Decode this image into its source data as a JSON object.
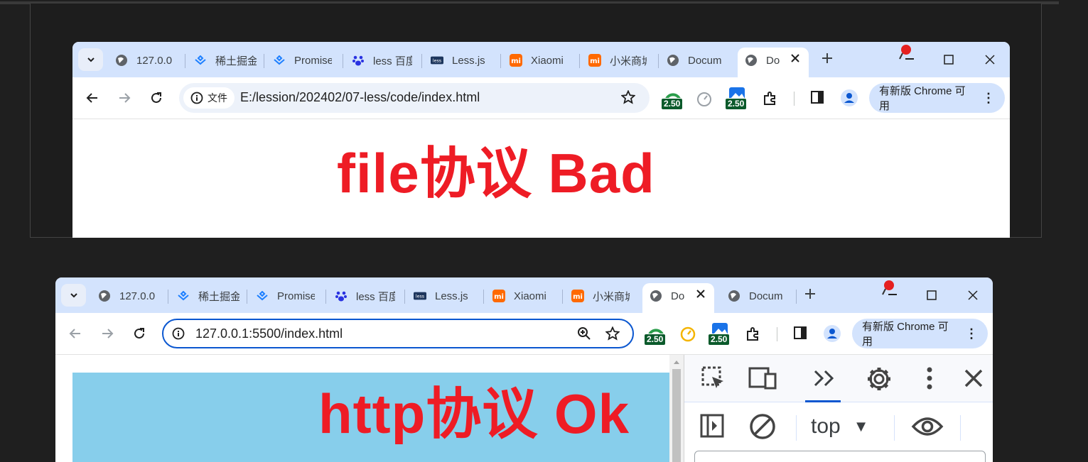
{
  "window_a": {
    "tabs": [
      {
        "title": "127.0.0",
        "icon": "globe-icon"
      },
      {
        "title": "稀土掘金",
        "icon": "juejin-icon"
      },
      {
        "title": "Promise",
        "icon": "juejin-icon"
      },
      {
        "title": "less 百度",
        "icon": "baidu-paw-icon"
      },
      {
        "title": "Less.js",
        "icon": "less-logo-icon"
      },
      {
        "title": "Xiaomi",
        "icon": "mi-logo-icon"
      },
      {
        "title": "小米商城",
        "icon": "mi-logo-icon"
      },
      {
        "title": "Docum",
        "icon": "globe-icon"
      },
      {
        "title": "Do",
        "icon": "globe-icon",
        "active": true
      }
    ],
    "security_chip": "文件",
    "url": "E:/lession/202402/07-less/code/index.html",
    "ext_badge_1": "2.50",
    "ext_badge_2": "2.50",
    "update_label": "有新版 Chrome 可用",
    "heading": "file协议  Bad"
  },
  "window_b": {
    "tabs": [
      {
        "title": "127.0.0",
        "icon": "globe-icon"
      },
      {
        "title": "稀土掘金",
        "icon": "juejin-icon"
      },
      {
        "title": "Promise",
        "icon": "juejin-icon"
      },
      {
        "title": "less 百度",
        "icon": "baidu-paw-icon"
      },
      {
        "title": "Less.js",
        "icon": "less-logo-icon"
      },
      {
        "title": "Xiaomi",
        "icon": "mi-logo-icon"
      },
      {
        "title": "小米商城",
        "icon": "mi-logo-icon"
      },
      {
        "title": "Do",
        "icon": "globe-icon",
        "active": true
      },
      {
        "title": "Docum",
        "icon": "globe-icon"
      }
    ],
    "url": "127.0.0.1:5500/index.html",
    "ext_badge_1": "2.50",
    "ext_badge_2": "2.50",
    "update_label": "有新版 Chrome 可用",
    "heading": "http协议  Ok",
    "devtools": {
      "context_label": "top",
      "context_arrow": "▼"
    }
  },
  "colors": {
    "page_bg": "#1f1f1f",
    "tabstrip": "#d3e3fd",
    "heading_red": "#ee1c25",
    "sky_blue": "#87ceeb",
    "focus_blue": "#0b57d0"
  }
}
